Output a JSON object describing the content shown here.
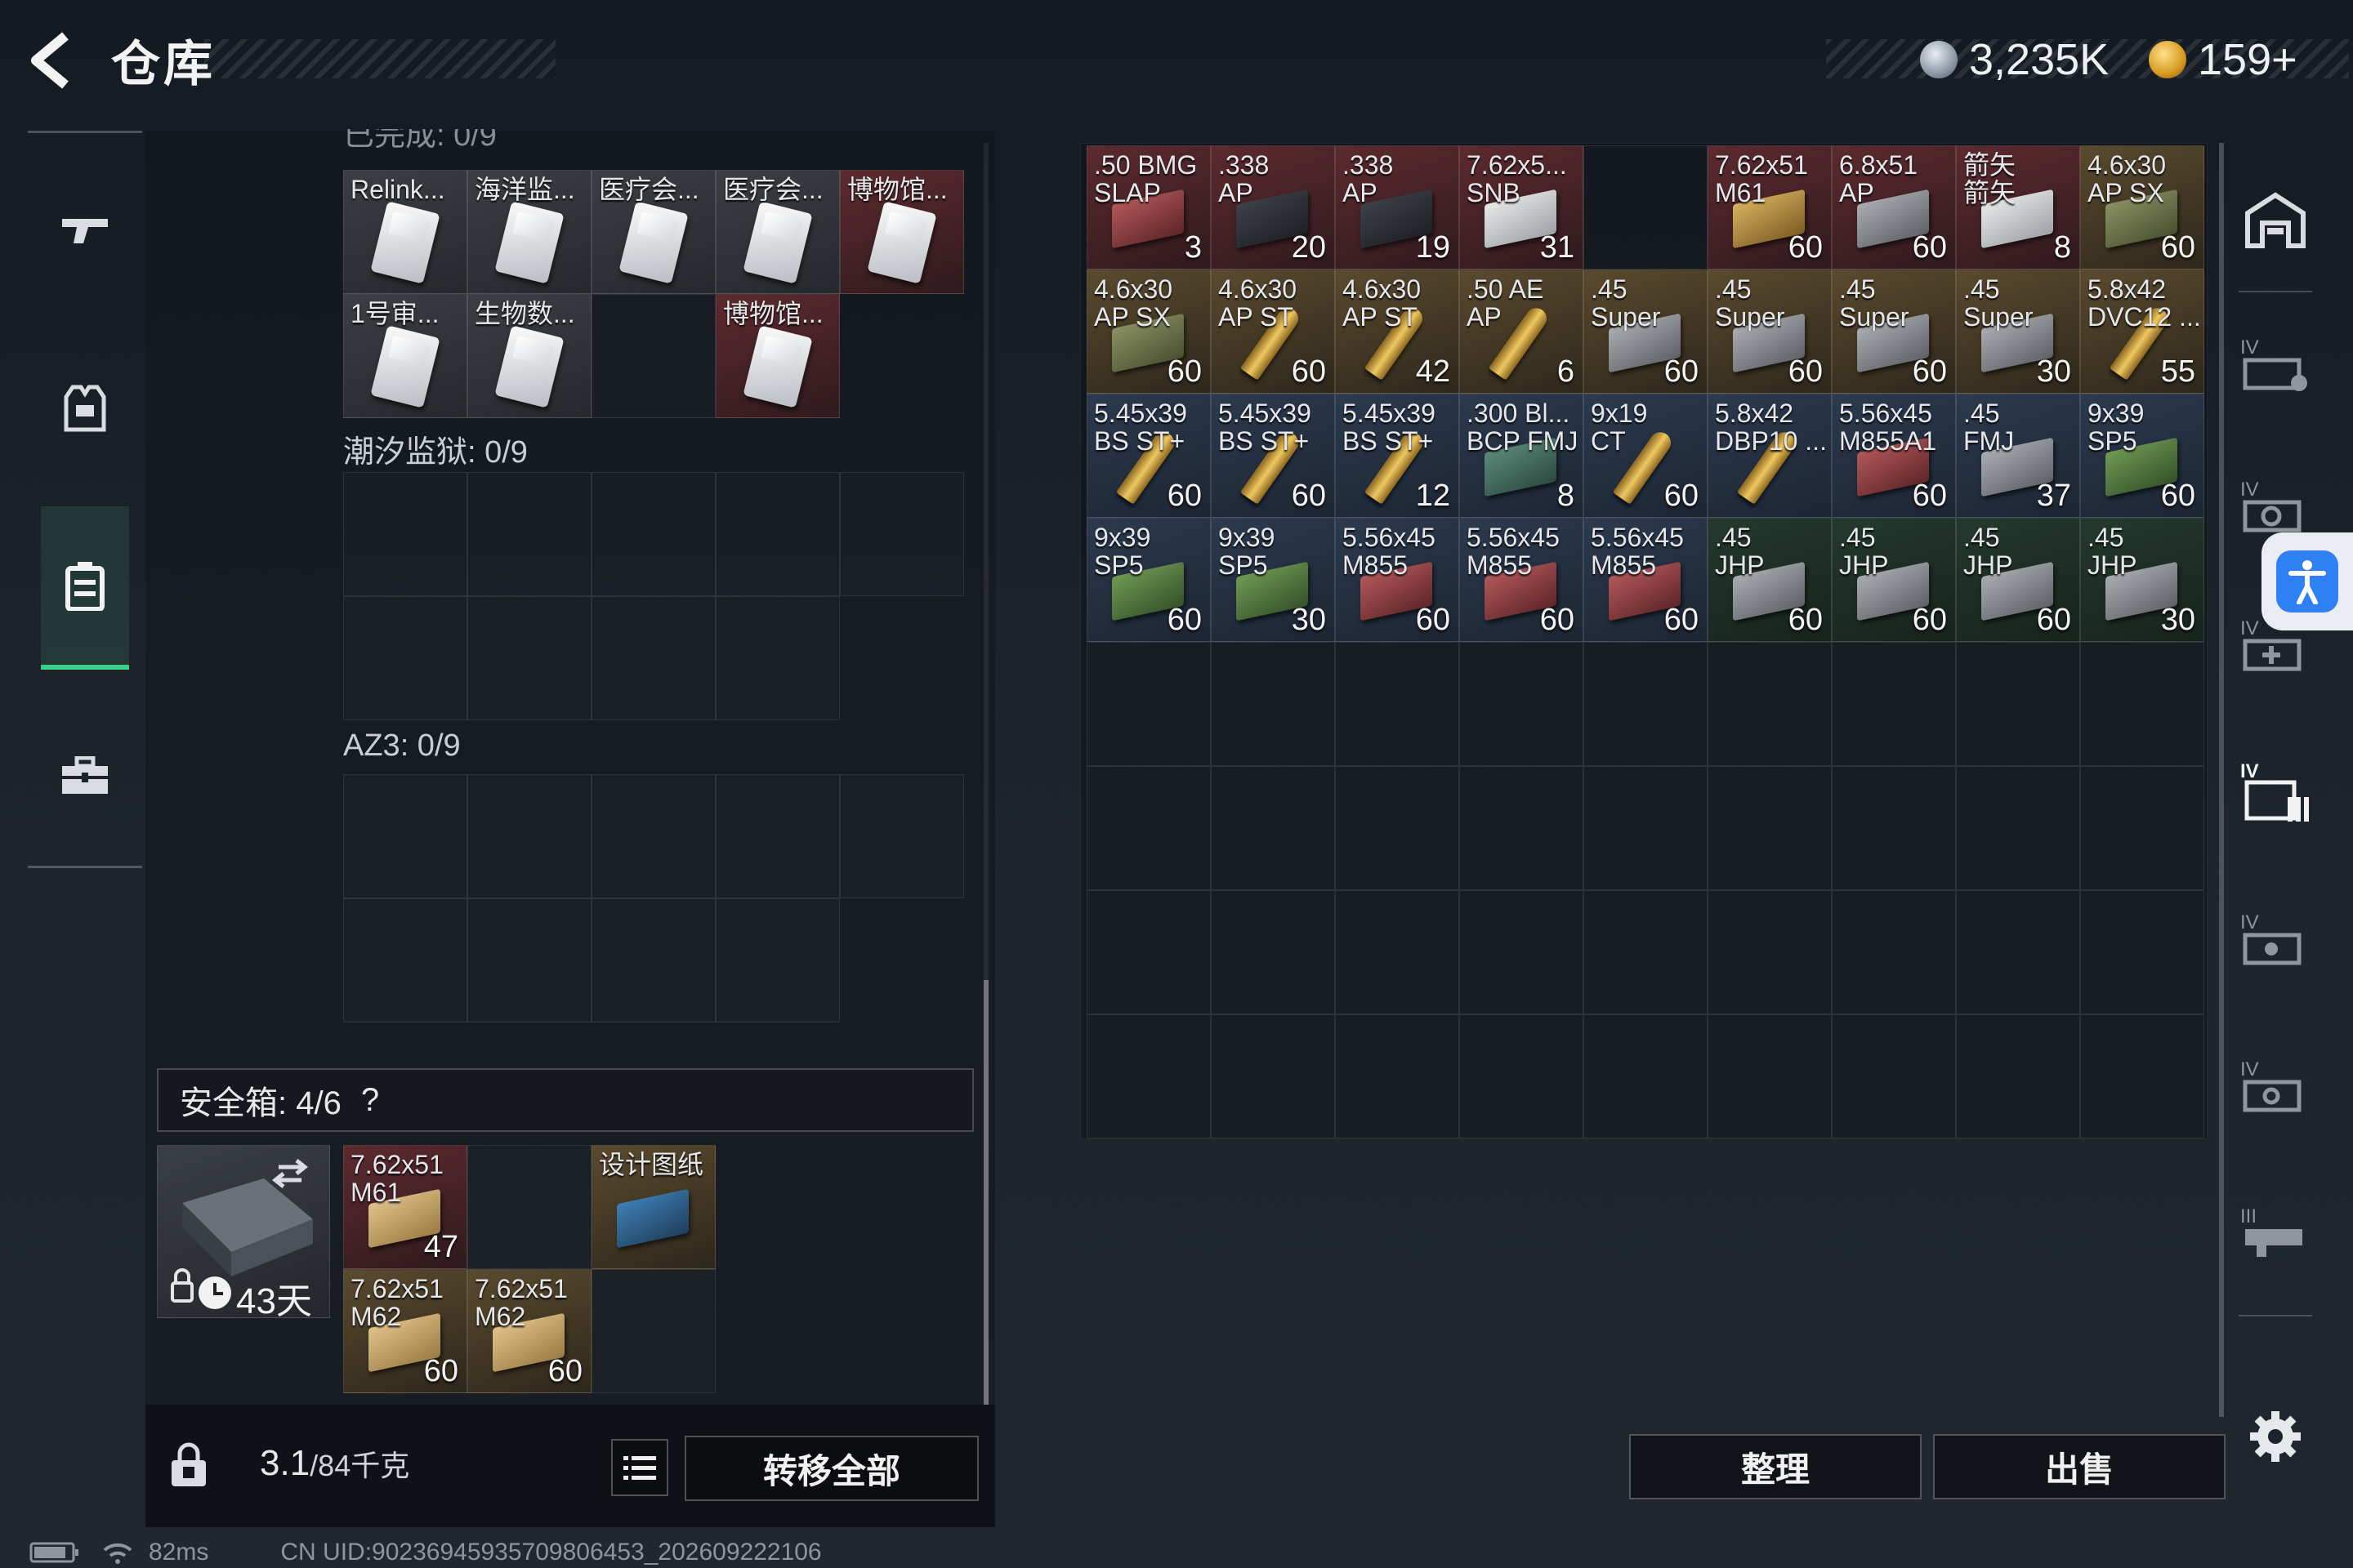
{
  "header": {
    "title": "仓库",
    "currency_1": "3,235K",
    "currency_2": "159+",
    "currency_1_icon": "silver-coin-icon",
    "currency_2_icon": "gold-triangle-coin-icon"
  },
  "left_nav": [
    {
      "icon": "gun-icon"
    },
    {
      "icon": "vest-icon"
    },
    {
      "icon": "backpack-icon",
      "active": true
    },
    {
      "icon": "toolbox-icon"
    }
  ],
  "left_panel": {
    "partial_label": "已完成: 0/9",
    "section1_items": [
      {
        "name": "Relink...",
        "bg": "gray"
      },
      {
        "name": "海洋监...",
        "bg": "gray"
      },
      {
        "name": "医疗会...",
        "bg": "gray"
      },
      {
        "name": "医疗会...",
        "bg": "gray"
      },
      {
        "name": "博物馆...",
        "bg": "red"
      },
      {
        "name": "1号审...",
        "bg": "gray"
      },
      {
        "name": "生物数...",
        "bg": "gray"
      },
      {
        "name": "",
        "bg": "empty"
      },
      {
        "name": "博物馆...",
        "bg": "red"
      }
    ],
    "section2_label": "潮汐监狱: 0/9",
    "section3_label": "AZ3: 0/9",
    "safebox": {
      "label": "安全箱: 4/6",
      "help": "?",
      "days": "43天",
      "items": [
        {
          "name": "7.62x51\nM61",
          "count": "47",
          "bg": "red",
          "pic": "box",
          "box": "sand"
        },
        {
          "name": "",
          "count": "",
          "bg": "empty",
          "pic": "",
          "box": ""
        },
        {
          "name": "设计图纸",
          "count": "",
          "bg": "gold",
          "pic": "box",
          "box": "blueprint"
        },
        {
          "name": "7.62x51\nM62",
          "count": "60",
          "bg": "gold",
          "pic": "box",
          "box": "sand"
        },
        {
          "name": "7.62x51\nM62",
          "count": "60",
          "bg": "gold",
          "pic": "box",
          "box": "sand"
        },
        {
          "name": "",
          "count": "",
          "bg": "empty",
          "pic": "",
          "box": ""
        }
      ]
    }
  },
  "bottom_left": {
    "weight_value": "3.1",
    "weight_max": "/84千克",
    "transfer_all": "转移全部"
  },
  "storage_items": [
    {
      "name": ".50 BMG\nSLAP",
      "count": "3",
      "bg": "red",
      "pic": "box",
      "box": "red"
    },
    {
      "name": ".338\nAP",
      "count": "20",
      "bg": "red",
      "pic": "box",
      "box": "dark"
    },
    {
      "name": ".338\nAP",
      "count": "19",
      "bg": "red",
      "pic": "box",
      "box": "dark"
    },
    {
      "name": "7.62x5...\nSNB",
      "count": "31",
      "bg": "red",
      "pic": "box",
      "box": "white"
    },
    {
      "name": "",
      "count": "",
      "bg": "empty",
      "pic": "",
      "box": ""
    },
    {
      "name": "7.62x51\nM61",
      "count": "60",
      "bg": "red",
      "pic": "box",
      "box": "gold"
    },
    {
      "name": "6.8x51\nAP",
      "count": "60",
      "bg": "red",
      "pic": "box",
      "box": "gray"
    },
    {
      "name": "箭矢\n箭矢",
      "count": "8",
      "bg": "red",
      "pic": "box",
      "box": "white"
    },
    {
      "name": "4.6x30\nAP SX",
      "count": "60",
      "bg": "gold",
      "pic": "box",
      "box": "olive"
    },
    {
      "name": "4.6x30\nAP SX",
      "count": "60",
      "bg": "gold",
      "pic": "box",
      "box": "olive"
    },
    {
      "name": "4.6x30\nAP ST",
      "count": "60",
      "bg": "gold",
      "pic": "bullet",
      "box": ""
    },
    {
      "name": "4.6x30\nAP ST",
      "count": "42",
      "bg": "gold",
      "pic": "bullet",
      "box": ""
    },
    {
      "name": ".50 AE\nAP",
      "count": "6",
      "bg": "gold",
      "pic": "bullet",
      "box": ""
    },
    {
      "name": ".45\nSuper",
      "count": "60",
      "bg": "gold",
      "pic": "box",
      "box": "gray"
    },
    {
      "name": ".45\nSuper",
      "count": "60",
      "bg": "gold",
      "pic": "box",
      "box": "gray"
    },
    {
      "name": ".45\nSuper",
      "count": "60",
      "bg": "gold",
      "pic": "box",
      "box": "gray"
    },
    {
      "name": ".45\nSuper",
      "count": "30",
      "bg": "gold",
      "pic": "box",
      "box": "gray"
    },
    {
      "name": "5.8x42\nDVC12 ...",
      "count": "55",
      "bg": "gold",
      "pic": "bullet",
      "box": ""
    },
    {
      "name": "5.45x39\nBS ST+",
      "count": "60",
      "bg": "blue",
      "pic": "bullet",
      "box": ""
    },
    {
      "name": "5.45x39\nBS ST+",
      "count": "60",
      "bg": "blue",
      "pic": "bullet",
      "box": ""
    },
    {
      "name": "5.45x39\nBS ST+",
      "count": "12",
      "bg": "blue",
      "pic": "bullet",
      "box": ""
    },
    {
      "name": ".300 Bl...\nBCP FMJ",
      "count": "8",
      "bg": "blue",
      "pic": "box",
      "box": "teal"
    },
    {
      "name": "9x19\nCT",
      "count": "60",
      "bg": "blue",
      "pic": "bullet",
      "box": ""
    },
    {
      "name": "5.8x42\nDBP10 ...",
      "count": "",
      "bg": "blue",
      "pic": "bullet",
      "box": ""
    },
    {
      "name": "5.56x45\nM855A1",
      "count": "60",
      "bg": "blue",
      "pic": "box",
      "box": "red"
    },
    {
      "name": ".45\nFMJ",
      "count": "37",
      "bg": "blue",
      "pic": "box",
      "box": "gray"
    },
    {
      "name": "9x39\nSP5",
      "count": "60",
      "bg": "blue",
      "pic": "box",
      "box": "green"
    },
    {
      "name": "9x39\nSP5",
      "count": "60",
      "bg": "blue",
      "pic": "box",
      "box": "green"
    },
    {
      "name": "9x39\nSP5",
      "count": "30",
      "bg": "blue",
      "pic": "box",
      "box": "green"
    },
    {
      "name": "5.56x45\nM855",
      "count": "60",
      "bg": "blue",
      "pic": "box",
      "box": "red"
    },
    {
      "name": "5.56x45\nM855",
      "count": "60",
      "bg": "blue",
      "pic": "box",
      "box": "red"
    },
    {
      "name": "5.56x45\nM855",
      "count": "60",
      "bg": "blue",
      "pic": "box",
      "box": "red"
    },
    {
      "name": ".45\nJHP",
      "count": "60",
      "bg": "green",
      "pic": "box",
      "box": "gray"
    },
    {
      "name": ".45\nJHP",
      "count": "60",
      "bg": "green",
      "pic": "box",
      "box": "gray"
    },
    {
      "name": ".45\nJHP",
      "count": "60",
      "bg": "green",
      "pic": "box",
      "box": "gray"
    },
    {
      "name": ".45\nJHP",
      "count": "30",
      "bg": "green",
      "pic": "box",
      "box": "gray"
    }
  ],
  "bottom_right": {
    "sort": "整理",
    "sell": "出售"
  },
  "right_rail": [
    {
      "icon": "warehouse-icon"
    },
    {
      "icon": "ammo-case-iv-icon"
    },
    {
      "icon": "gear-case-iv-icon"
    },
    {
      "icon": "medical-case-iv-icon"
    },
    {
      "icon": "storage-case-iv-icon",
      "active": true
    },
    {
      "icon": "parts-case-iv-icon"
    },
    {
      "icon": "parts-case-iv-2-icon"
    },
    {
      "icon": "weapon-case-iii-icon"
    }
  ],
  "status": {
    "ping": "82ms",
    "uid": "CN UID:9023694593570980645​3_202609222106"
  },
  "colors": {
    "accent_green": "#3ccf8a",
    "accessibility_blue": "#2f7ff5"
  }
}
